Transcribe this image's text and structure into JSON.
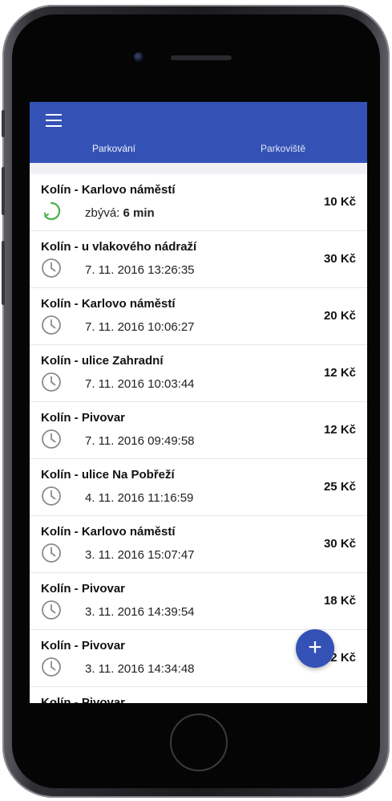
{
  "header": {
    "tabs": [
      {
        "label": "Parkování",
        "active": true
      },
      {
        "label": "Parkoviště",
        "active": false
      }
    ],
    "accent_color": "#3452b6"
  },
  "active_session": {
    "title": "Kolín - Karlovo náměstí",
    "remaining_label": "zbývá:",
    "remaining_value": "6 min",
    "price": "10 Kč",
    "progress_color": "#4caf50"
  },
  "history": [
    {
      "title": "Kolín - u vlakového nádraží",
      "datetime": "7. 11. 2016 13:26:35",
      "price": "30 Kč",
      "icon": "clock-icon"
    },
    {
      "title": "Kolín - Karlovo náměstí",
      "datetime": "7. 11. 2016 10:06:27",
      "price": "20 Kč",
      "icon": "clock-icon"
    },
    {
      "title": "Kolín - ulice Zahradní",
      "datetime": "7. 11. 2016 10:03:44",
      "price": "12 Kč",
      "icon": "clock-icon"
    },
    {
      "title": "Kolín - Pivovar",
      "datetime": "7. 11. 2016 09:49:58",
      "price": "12 Kč",
      "icon": "clock-icon"
    },
    {
      "title": "Kolín - ulice Na Pobřeží",
      "datetime": "4. 11. 2016 11:16:59",
      "price": "25 Kč",
      "icon": "clock-icon"
    },
    {
      "title": "Kolín - Karlovo náměstí",
      "datetime": "3. 11. 2016 15:07:47",
      "price": "30 Kč",
      "icon": "clock-icon"
    },
    {
      "title": "Kolín - Pivovar",
      "datetime": "3. 11. 2016 14:39:54",
      "price": "18 Kč",
      "icon": "clock-icon"
    },
    {
      "title": "Kolín - Pivovar",
      "datetime": "3. 11. 2016 14:34:48",
      "price": "12 Kč",
      "icon": "clock-icon"
    }
  ],
  "cutoff_title": "Kolín - Pivovar",
  "fab": {
    "label": "+",
    "icon": "plus-icon"
  }
}
